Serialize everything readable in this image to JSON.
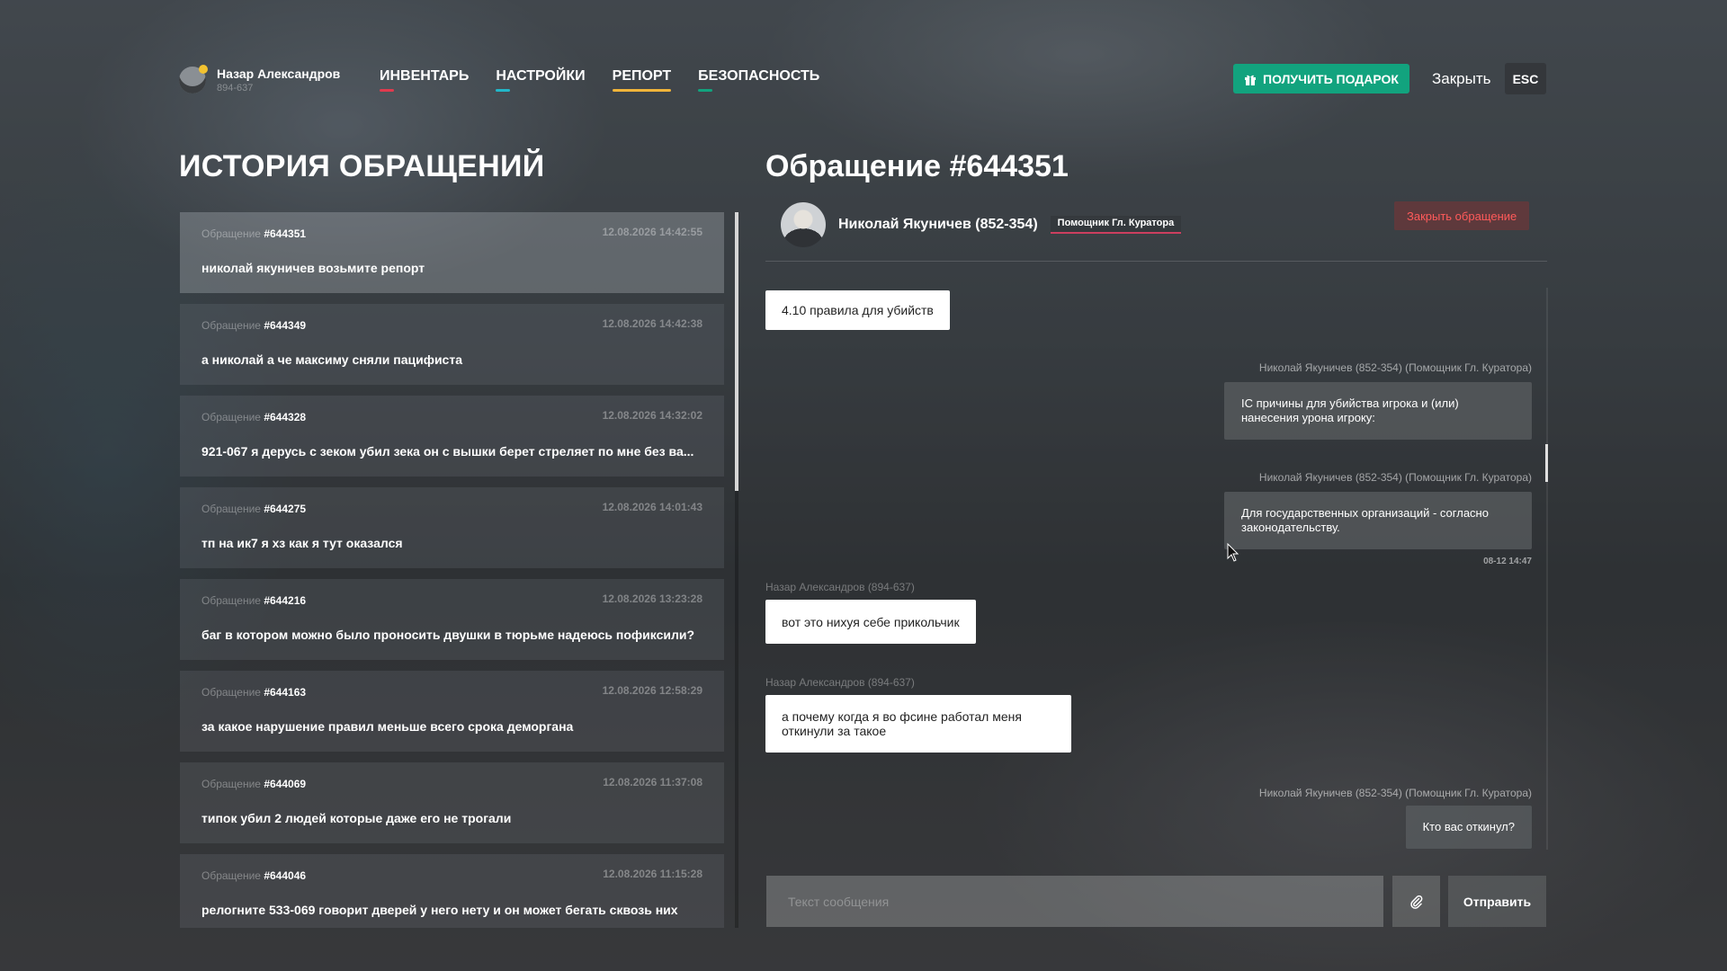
{
  "header": {
    "user": {
      "name": "Назар Александров",
      "id": "894-637",
      "status_color": "#f2c230"
    },
    "nav": [
      {
        "label": "ИНВЕНТАРЬ",
        "color": "#e03a4e",
        "active": false
      },
      {
        "label": "НАСТРОЙКИ",
        "color": "#22b7c9",
        "active": false
      },
      {
        "label": "РЕПОРТ",
        "color": "#f0b43a",
        "active": true
      },
      {
        "label": "БЕЗОПАСНОСТЬ",
        "color": "#12a37e",
        "active": false
      }
    ],
    "gift_button": "ПОЛУЧИТЬ ПОДАРОК",
    "gift_icon": "gift-icon",
    "close_label": "Закрыть",
    "esc_label": "ESC",
    "accent_color": "#12a37e"
  },
  "history": {
    "title": "ИСТОРИЯ ОБРАЩЕНИЙ",
    "prefix": "Обращение",
    "tickets": [
      {
        "id": "#644351",
        "date": "12.08.2026 14:42:55",
        "text": "николай якуничев возьмите репорт",
        "active": true
      },
      {
        "id": "#644349",
        "date": "12.08.2026 14:42:38",
        "text": "а николай а че максиму сняли пацифиста",
        "active": false
      },
      {
        "id": "#644328",
        "date": "12.08.2026 14:32:02",
        "text": "921-067 я дерусь с зеком убил зека он с вышки берет стреляет по мне без ва...",
        "active": false
      },
      {
        "id": "#644275",
        "date": "12.08.2026 14:01:43",
        "text": "тп на ик7 я хз как я тут оказался",
        "active": false
      },
      {
        "id": "#644216",
        "date": "12.08.2026 13:23:28",
        "text": "баг в котором можно было проносить двушки в тюрьме надеюсь пофиксили?",
        "active": false
      },
      {
        "id": "#644163",
        "date": "12.08.2026 12:58:29",
        "text": "за какое нарушение правил меньше всего срока деморгана",
        "active": false
      },
      {
        "id": "#644069",
        "date": "12.08.2026 11:37:08",
        "text": "типок убил 2 людей которые даже его не трогали",
        "active": false
      },
      {
        "id": "#644046",
        "date": "12.08.2026 11:15:28",
        "text": "релогните 533-069 говорит дверей у него нету и он может бегать сквозь них",
        "active": false
      }
    ]
  },
  "ticket": {
    "title": "Обращение #644351",
    "agent_name": "Николай Якуничев (852-354)",
    "agent_role": "Помощник Гл. Куратора",
    "close_ticket_label": "Закрыть обращение",
    "messages": [
      {
        "side": "left",
        "author": "",
        "text": "4.10 правила для убийств"
      },
      {
        "side": "right",
        "author": "Николай Якуничев (852-354) (Помощник Гл. Куратора)",
        "text": "IC причины для убийства игрока и (или) нанесения урона игроку:"
      },
      {
        "side": "right",
        "author": "Николай Якуничев (852-354) (Помощник Гл. Куратора)",
        "text": "Для государственных организаций - согласно законодательству.",
        "time": "08-12 14:47"
      },
      {
        "side": "left",
        "author": "Назар Александров (894-637)",
        "text": "вот это нихуя себе прикольчик"
      },
      {
        "side": "left",
        "author": "Назар Александров (894-637)",
        "text": "а почему когда я во фсине работал меня откинули за такое"
      },
      {
        "side": "right",
        "author": "Николай Якуничев (852-354) (Помощник Гл. Куратора)",
        "text": "Кто вас откинул?"
      }
    ],
    "input_placeholder": "Текст сообщения",
    "attach_icon": "paperclip-icon",
    "send_label": "Отправить"
  }
}
